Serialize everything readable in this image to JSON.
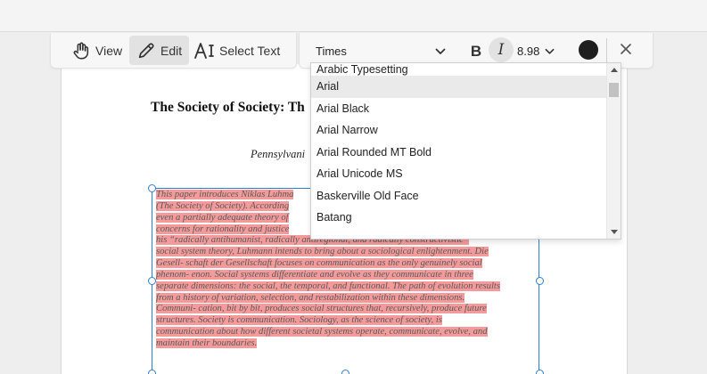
{
  "toolbar": {
    "view_label": "View",
    "edit_label": "Edit",
    "select_text_label": "Select Text"
  },
  "format": {
    "font_family": "Times",
    "bold_label": "B",
    "italic_label": "I",
    "font_size": "8.98",
    "text_color": "#1f1f1f",
    "close_label": "×"
  },
  "font_dropdown": {
    "items": [
      "Arabic Typesetting",
      "Arial",
      "Arial Black",
      "Arial Narrow",
      "Arial Rounded MT Bold",
      "Arial Unicode MS",
      "Baskerville Old Face",
      "Batang"
    ],
    "selected": "Arial"
  },
  "document": {
    "title": "The Society of Society: Th",
    "affiliation": "Pennsylvani",
    "abstract_lines": [
      "This paper introduces Niklas Luhma",
      "(The Society of Society). According",
      "even a partially adequate theory of",
      "concerns for rationality and justice",
      " his “radically antihumanist, radically antiregional, and radically constructivistic”",
      "social system theory, Luhmann intends to bring about a sociological enlightenment. Die",
      " Gesell- schaft der Gesellschaft focuses on communication as the only genuinely social",
      "phenom- enon. Social systems differentiate and evolve as they communicate in three",
      "separate dimensions: the social, the temporal, and functional. The path of evolution results",
      "from a history of variation, selection, and restabilization within these dimensions.",
      "Communi- cation, bit by bit, produces social structures that, recursively, produce future",
      " structures. Society is communication. Sociology, as the science of society, is",
      "communication about how different societal systems operate, communicate, evolve, and",
      "maintain their boundaries."
    ]
  },
  "colors": {
    "highlight": "#f59a9a",
    "selection_border": "#2f7fd1",
    "active_button_bg": "#e2e2e2"
  },
  "icons": [
    "hand-icon",
    "pencil-icon",
    "select-text-icon",
    "chevron-down-icon",
    "close-icon"
  ]
}
